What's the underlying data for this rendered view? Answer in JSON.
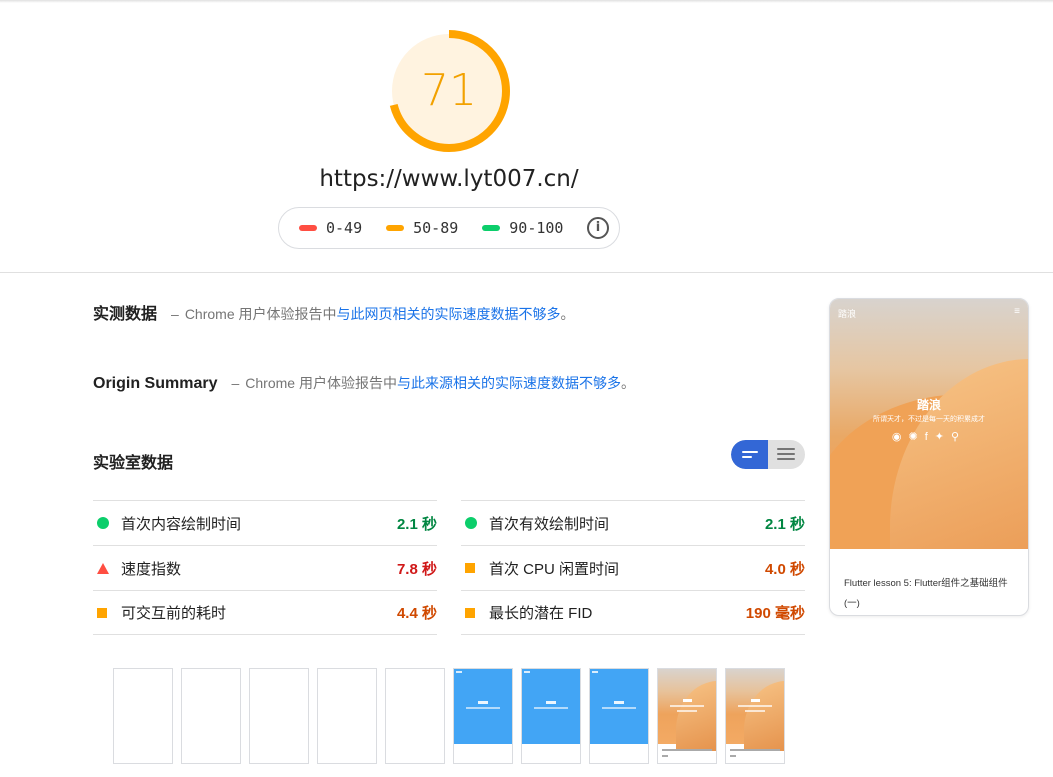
{
  "report": {
    "score": "71",
    "score_fraction": 0.71,
    "url": "https://www.lyt007.cn/",
    "gauge_color": "#ffa400",
    "gauge_bg": "#fff3e0"
  },
  "legend": {
    "items": [
      {
        "label": "0-49",
        "color": "#ff4e42"
      },
      {
        "label": "50-89",
        "color": "#ffa400"
      },
      {
        "label": "90-100",
        "color": "#0cce6b"
      }
    ],
    "info_icon": "info-icon"
  },
  "field_data": {
    "title": "实测数据",
    "dash": "–",
    "prefix": "Chrome 用户体验报告中",
    "link": "与此网页相关的实际速度数据不够多",
    "suffix": "。"
  },
  "origin_summary": {
    "title": "Origin Summary",
    "dash": "–",
    "prefix": "Chrome 用户体验报告中",
    "link": "与此来源相关的实际速度数据不够多",
    "suffix": "。"
  },
  "lab_data": {
    "title": "实验室数据",
    "metrics_left": [
      {
        "label": "首次内容绘制时间",
        "value": "2.1 秒",
        "status": "pass"
      },
      {
        "label": "速度指数",
        "value": "7.8 秒",
        "status": "fail"
      },
      {
        "label": "可交互前的耗时",
        "value": "4.4 秒",
        "status": "average"
      }
    ],
    "metrics_right": [
      {
        "label": "首次有效绘制时间",
        "value": "2.1 秒",
        "status": "pass"
      },
      {
        "label": "首次 CPU 闲置时间",
        "value": "4.0 秒",
        "status": "average"
      },
      {
        "label": "最长的潜在 FID",
        "value": "190 毫秒",
        "status": "average"
      }
    ]
  },
  "screenshot": {
    "logo": "踏浪",
    "menu_icon": "menu-icon",
    "site_name": "踏浪",
    "tagline": "所谓天才，不过是每一天的积累成才",
    "icons": "◉✺f✦⚲",
    "post_title": "Flutter lesson 5: Flutter组件之基础组件(一)"
  },
  "filmstrip": [
    "blank",
    "blank",
    "blank",
    "blank",
    "blank",
    "blue",
    "blue",
    "blue",
    "desert",
    "desert"
  ]
}
